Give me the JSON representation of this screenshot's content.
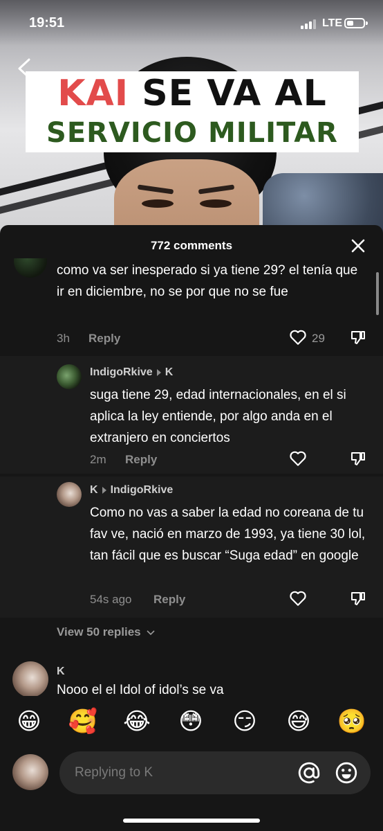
{
  "status_bar": {
    "time": "19:51",
    "network": "LTE"
  },
  "video": {
    "title_line1_highlight": "KAI",
    "title_line1_rest": " SE VA AL",
    "title_line2": "SERVICIO MILITAR"
  },
  "comments_sheet": {
    "count_label": "772 comments",
    "comments": [
      {
        "text": "como va ser inesperado si ya tiene 29? el tenía que ir en diciembre, no se por que no se fue",
        "time": "3h",
        "reply_label": "Reply",
        "likes": "29"
      },
      {
        "user": "IndigoRkive",
        "reply_to": "K",
        "text": "suga tiene 29, edad internacionales, en el si aplica la ley entiende, por algo anda en el extranjero en conciertos",
        "time": "2m",
        "reply_label": "Reply"
      },
      {
        "user": "K",
        "reply_to": "IndigoRkive",
        "text": "Como no vas a saber la edad no coreana de tu fav ve, nació en marzo de 1993, ya tiene 30 lol, tan fácil que es buscar “Suga edad” en google",
        "time": "54s ago",
        "reply_label": "Reply"
      }
    ],
    "view_replies_label": "View 50 replies",
    "next_comment": {
      "user": "K",
      "text": "Nooo el el Idol of idol’s se va"
    }
  },
  "emoji_bar": [
    "😁",
    "🥰",
    "😂",
    "😳",
    "😏",
    "😅",
    "🥺"
  ],
  "input": {
    "placeholder": "Replying to K"
  }
}
